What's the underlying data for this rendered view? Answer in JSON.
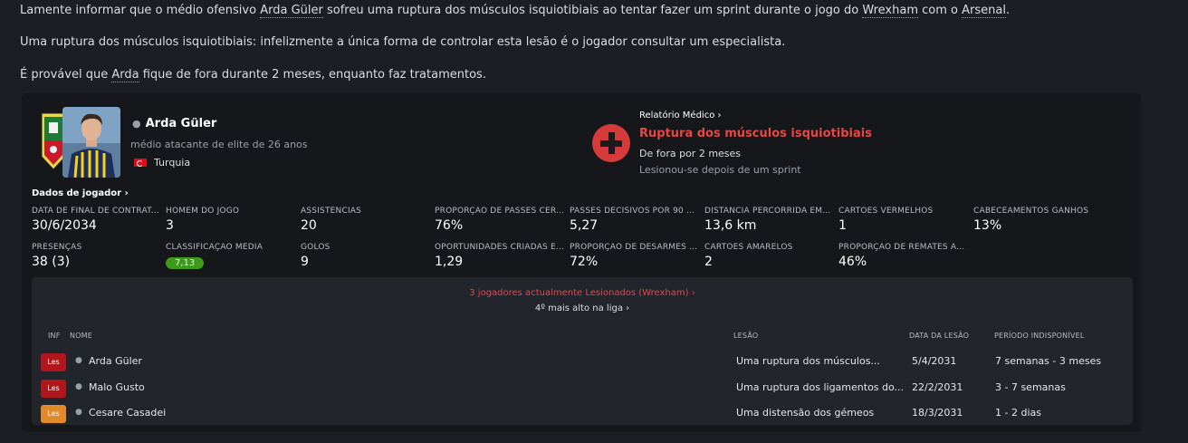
{
  "message": {
    "line1": {
      "p1": "Lamente informar que o médio ofensivo ",
      "player": "Arda Güler",
      "p2": " sofreu uma ruptura dos músculos isquiotibiais ao tentar fazer um sprint durante o jogo do ",
      "team1": "Wrexham",
      "p3": " com o ",
      "team2": "Arsenal",
      "p4": "."
    },
    "line2": "Uma ruptura dos músculos isquiotibiais: infelizmente a única forma de controlar esta lesão é o jogador consultar um especialista.",
    "line3": {
      "p1": "É provável que ",
      "player": "Arda",
      "p2": " fique de fora durante 2 meses, enquanto faz tratamentos."
    }
  },
  "player": {
    "name": "Arda Güler",
    "role": "médio atacante de elite de 26 anos",
    "nation": "Turquia"
  },
  "medical": {
    "link": "Relatório Médico",
    "injury": "Ruptura dos músculos isquiotibiais",
    "out": "De fora por 2 meses",
    "cause": "Lesionou-se depois de um sprint",
    "accent": "#e84646"
  },
  "player_data_link": "Dados de jogador",
  "stats": [
    {
      "label": "DATA DE FINAL DE CONTRAT...",
      "value": "30/6/2034"
    },
    {
      "label": "HOMEM DO JOGO",
      "value": "3"
    },
    {
      "label": "ASSISTÊNCIAS",
      "value": "20"
    },
    {
      "label": "PROPORÇÃO DE PASSES CER...",
      "value": "76%"
    },
    {
      "label": "PASSES DECISIVOS POR 90 M...",
      "value": "5,27"
    },
    {
      "label": "DISTÂNCIA PERCORRIDA EM...",
      "value": "13,6 km"
    },
    {
      "label": "CARTÕES VERMELHOS",
      "value": "1"
    },
    {
      "label": "CABECEAMENTOS GANHOS",
      "value": "13%"
    },
    {
      "label": "PRESENÇAS",
      "value": "38 (3)"
    },
    {
      "label": "CLASSIFICAÇÃO MÉDIA",
      "value": "7,13",
      "rating_color": "#3e9b1a"
    },
    {
      "label": "GOLOS",
      "value": "9"
    },
    {
      "label": "OPORTUNIDADES CRIADAS E...",
      "value": "1,29"
    },
    {
      "label": "PROPORÇÃO DE DESARMES C...",
      "value": "72%"
    },
    {
      "label": "CARTÕES AMARELOS",
      "value": "2"
    },
    {
      "label": "PROPORÇÃO DE REMATES À...",
      "value": "46%"
    }
  ],
  "injured": {
    "link": "3 jogadores actualmente Lesionados (Wrexham)",
    "league": "4º mais alto na liga",
    "headers": {
      "inf": "INF",
      "name": "NOME",
      "injury": "LESÃO",
      "date": "DATA DA LESÃO",
      "period": "PERÍODO INDISPONÍVEL"
    },
    "rows": [
      {
        "badge": "Les",
        "badge_color": "#b0161c",
        "name": "Arda Güler",
        "injury": "Uma ruptura dos músculos...",
        "date": "5/4/2031",
        "period": "7 semanas - 3 meses"
      },
      {
        "badge": "Les",
        "badge_color": "#b0161c",
        "name": "Malo Gusto",
        "injury": "Uma ruptura dos ligamentos do...",
        "date": "22/2/2031",
        "period": "3 - 7 semanas"
      },
      {
        "badge": "Les",
        "badge_color": "#e08a2a",
        "name": "Cesare Casadei",
        "injury": "Uma distensão dos gémeos",
        "date": "18/3/2031",
        "period": "1 - 2 dias"
      }
    ]
  }
}
